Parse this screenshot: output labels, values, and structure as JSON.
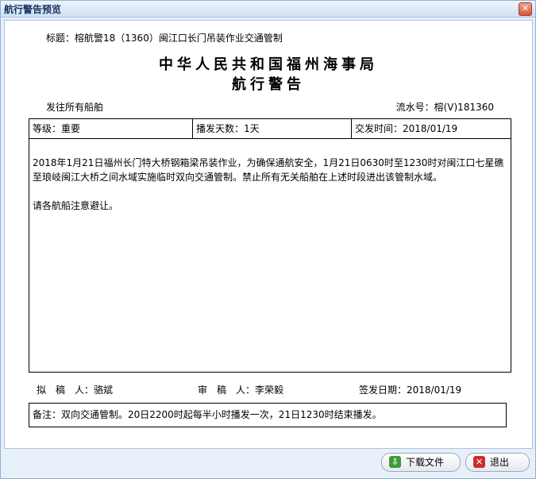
{
  "window": {
    "title": "航行警告预览",
    "close_glyph": "✕"
  },
  "header": {
    "subject_label": "标题：",
    "subject": "榕航警18（1360）闽江口长门吊装作业交通管制",
    "org": "中华人民共和国福州海事局",
    "doc_type": "航行警告",
    "recipient": "发往所有船舶",
    "serial_label": "流水号：",
    "serial": "榕(V)181360"
  },
  "info": {
    "level": "等级：重要",
    "broadcast_days": "播发天数：1天",
    "issue_time": "交发时间：2018/01/19"
  },
  "body": {
    "paragraph": "2018年1月21日福州长门特大桥钢箱梁吊装作业，为确保通航安全，1月21日0630时至1230时对闽江口七星礁至琅岐闽江大桥之间水域实施临时双向交通管制。禁止所有无关船舶在上述时段进出该管制水域。",
    "notice": "请各航船注意避让。"
  },
  "signatures": {
    "drafter": "拟　稿　人：骆斌",
    "reviewer": "审　稿　人：李荣毅",
    "sign_date": "签发日期：2018/01/19"
  },
  "remark": "备注：双向交通管制。20日2200时起每半小时播发一次，21日1230时结束播发。",
  "buttons": {
    "download": "下载文件",
    "download_icon": "download-arrow",
    "exit": "退出",
    "exit_icon": "red-x"
  }
}
